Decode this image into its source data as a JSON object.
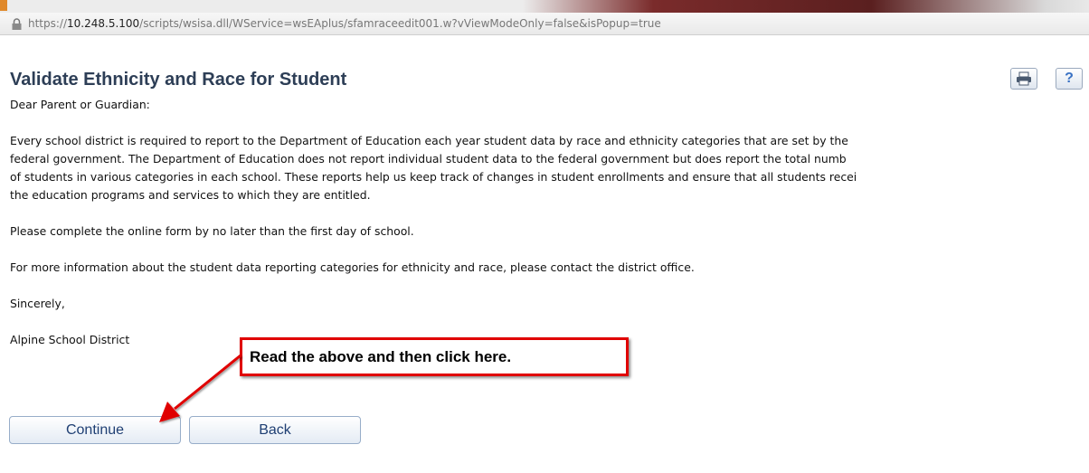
{
  "browser": {
    "url_prefix": "https://",
    "url_host": "10.248.5.100",
    "url_path": "/scripts/wsisa.dll/WService=wsEAplus/sfamraceedit001.w?vViewModeOnly=false&isPopup=true"
  },
  "page": {
    "title": "Validate Ethnicity and Race for Student"
  },
  "toolbar": {
    "print_icon": "printer-icon",
    "help_label": "?"
  },
  "letter": {
    "salutation": "Dear Parent or Guardian:",
    "para1_lines": [
      "Every school district is required to report to the Department of Education each year student data by race and ethnicity categories that are set by the",
      "federal government. The Department of Education does not report individual student data to the federal government but does report the total numb",
      "of students in various categories in each school. These reports help us keep track of changes in student enrollments and ensure that all students recei",
      "the education programs and services to which they are entitled."
    ],
    "para2": "Please complete the online form by no later than the first day of school.",
    "para3": "For more information about the student data reporting categories for ethnicity and race, please contact the district office.",
    "closing": "Sincerely,",
    "signature": "Alpine School District"
  },
  "buttons": {
    "continue_label": "Continue",
    "back_label": "Back"
  },
  "annotation": {
    "callout_text": "Read the above and then click here.",
    "callout_color": "#e00000"
  }
}
